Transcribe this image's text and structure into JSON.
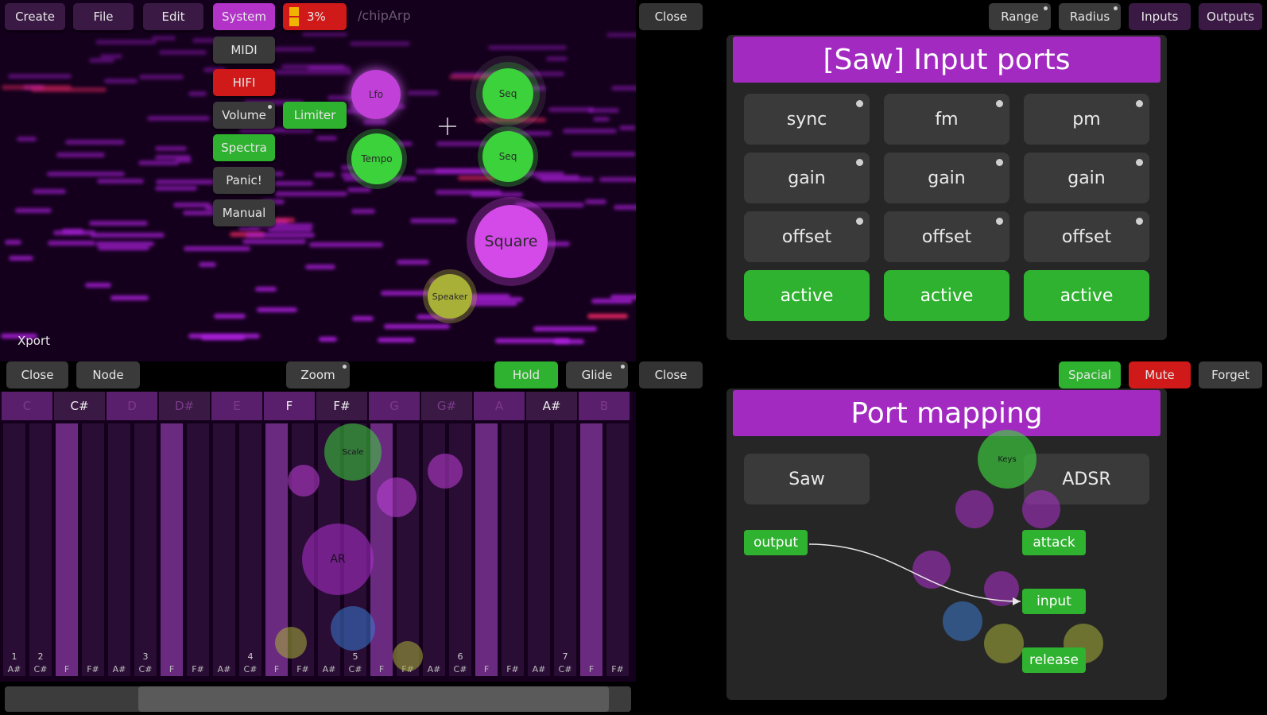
{
  "top_toolbar": {
    "create": "Create",
    "file": "File",
    "edit": "Edit",
    "system": "System",
    "cpu": "3%",
    "patch_path": "/chipArp",
    "close": "Close"
  },
  "system_menu": {
    "midi": "MIDI",
    "hifi": "HIFI",
    "volume": "Volume",
    "limiter": "Limiter",
    "spectra": "Spectra",
    "panic": "Panic!",
    "manual": "Manual"
  },
  "view_toolbar": {
    "range": "Range",
    "radius": "Radius",
    "inputs": "Inputs",
    "outputs": "Outputs"
  },
  "graph_nodes": {
    "lfo": "Lfo",
    "seq1": "Seq",
    "tempo": "Tempo",
    "seq2": "Seq",
    "square": "Square",
    "speaker": "Speaker"
  },
  "xport": "Xport",
  "roll_toolbar": {
    "close": "Close",
    "node": "Node",
    "zoom": "Zoom",
    "hold": "Hold",
    "glide": "Glide",
    "close2": "Close"
  },
  "note_headers": [
    "C",
    "C#",
    "D",
    "D#",
    "E",
    "F",
    "F#",
    "G",
    "G#",
    "A",
    "A#",
    "B"
  ],
  "roll_columns": [
    {
      "label": "A#",
      "num": "1"
    },
    {
      "label": "C#",
      "num": "2"
    },
    {
      "label": "F",
      "num": ""
    },
    {
      "label": "F#",
      "num": ""
    },
    {
      "label": "A#",
      "num": ""
    },
    {
      "label": "C#",
      "num": "3"
    },
    {
      "label": "F",
      "num": ""
    },
    {
      "label": "F#",
      "num": ""
    },
    {
      "label": "A#",
      "num": ""
    },
    {
      "label": "C#",
      "num": "4"
    },
    {
      "label": "F",
      "num": ""
    },
    {
      "label": "F#",
      "num": ""
    },
    {
      "label": "A#",
      "num": ""
    },
    {
      "label": "C#",
      "num": "5"
    },
    {
      "label": "F",
      "num": ""
    },
    {
      "label": "F#",
      "num": ""
    },
    {
      "label": "A#",
      "num": ""
    },
    {
      "label": "C#",
      "num": "6"
    },
    {
      "label": "F",
      "num": ""
    },
    {
      "label": "F#",
      "num": ""
    },
    {
      "label": "A#",
      "num": ""
    },
    {
      "label": "C#",
      "num": "7"
    },
    {
      "label": "F",
      "num": ""
    },
    {
      "label": "F#",
      "num": ""
    }
  ],
  "roll_ghost_nodes": {
    "scale": "Scale",
    "ar": "AR",
    "keys": "Keys"
  },
  "input_ports": {
    "title": "[Saw] Input ports",
    "row1": [
      "sync",
      "fm",
      "pm"
    ],
    "row2": [
      "gain",
      "gain",
      "gain"
    ],
    "row3": [
      "offset",
      "offset",
      "offset"
    ],
    "row4": [
      "active",
      "active",
      "active"
    ]
  },
  "mid_right": {
    "spacial": "Spacial",
    "mute": "Mute",
    "forget": "Forget"
  },
  "port_mapping": {
    "title": "Port mapping",
    "source": "Saw",
    "target": "ADSR",
    "output": "output",
    "inputs": [
      "attack",
      "input",
      "release"
    ]
  },
  "colors": {
    "accent_purple": "#a22ac0",
    "green": "#2fb22f",
    "red": "#d01919",
    "button_gray": "#3a3a3a"
  }
}
